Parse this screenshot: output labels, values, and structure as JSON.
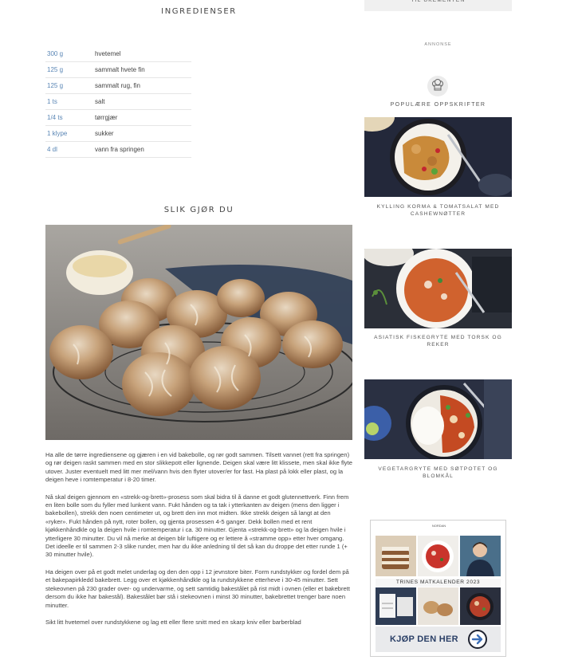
{
  "ingredients": {
    "title": "INGREDIENSER",
    "items": [
      {
        "amount": "300 g",
        "name": "hvetemel"
      },
      {
        "amount": "125 g",
        "name": "sammalt hvete fin"
      },
      {
        "amount": "125 g",
        "name": "sammalt rug, fin"
      },
      {
        "amount": "1 ts",
        "name": "salt"
      },
      {
        "amount": "1/4 ts",
        "name": "tørrgjær"
      },
      {
        "amount": "1 klype",
        "name": "sukker"
      },
      {
        "amount": "4 dl",
        "name": "vann fra springen"
      }
    ]
  },
  "method": {
    "title": "SLIK GJØR DU",
    "paragraphs": [
      "Ha alle de tørre ingrediensene og gjæren i en vid bakebolle, og rør godt sammen. Tilsett vannet (rett fra springen) og rør deigen raskt sammen med en stor slikkepott eller lignende. Deigen skal være litt klissete, men skal ikke flyte utover. Juster eventuelt med litt mer mel/vann hvis den flyter utover/er for fast. Ha plast på lokk eller plast, og la deigen heve i romtemperatur i 8-20 timer.",
      "Nå skal deigen gjennom en «strekk-og-brett»-prosess som skal bidra til å danne et godt glutennettverk. Finn frem en liten bolle som du fyller med lunkent vann. Fukt hånden og ta tak i ytterkanten av deigen (mens den ligger i bakebollen), strekk den noen centimeter ut, og brett den inn mot midten. Ikke strekk deigen så langt at den «ryker». Fukt hånden på nytt, roter bollen, og gjenta prosessen 4-5 ganger. Dekk bollen med et rent kjøkkenhåndkle og la deigen hvile i romtemperatur i ca. 30 minutter. Gjenta «strekk-og-brett» og la deigen hvile i ytterligere 30 minutter. Du vil nå merke at deigen blir luftigere og er lettere å «stramme opp» etter hver omgang. Det ideelle er til sammen 2-3 slike runder, men har du ikke anledning til det så kan du droppe det etter runde 1 (+ 30 minutter hvile).",
      "Ha deigen over på et godt melet underlag og den den opp i 12 jevnstore biter. Form rundstykker og fordel dem på et bakepapirkledd bakebrett. Legg over et kjøkkenhåndkle og la rundstykkene etterheve i 30-45 minutter. Sett stekeovnen på 230 grader over- og undervarme, og sett samtidig bakestålet på rist midt i ovnen (eller et bakebrett dersom du ikke har bakestål). Bakestålet bør stå i stekeovnen i minst 30 minutter, bakebrettet trenger bare noen minutter.",
      "Sikt litt hvetemel over rundstykkene og lag ett eller flere snitt med en skarp kniv eller barberblad"
    ]
  },
  "sidebar": {
    "menu_button": "TIL UKEMENYEN",
    "ad_label": "ANNONSE",
    "popular_title": "POPULÆRE OPPSKRIFTER",
    "recipes": [
      {
        "title": "KYLLING KORMA & TOMATSALAT MED CASHEWNØTTER"
      },
      {
        "title": "ASIATISK FISKEGRYTE MED TORSK OG REKER"
      },
      {
        "title": "VEGETARGRYTE MED SØTPOTET OG BLOMKÅL"
      }
    ]
  },
  "ad": {
    "brand": "NORDAN",
    "caption": "TRINES MATKALENDER 2023",
    "cta": "KJØP DEN HER"
  },
  "colors": {
    "amount": "#5a86b5",
    "cta": "#2a3f66"
  }
}
